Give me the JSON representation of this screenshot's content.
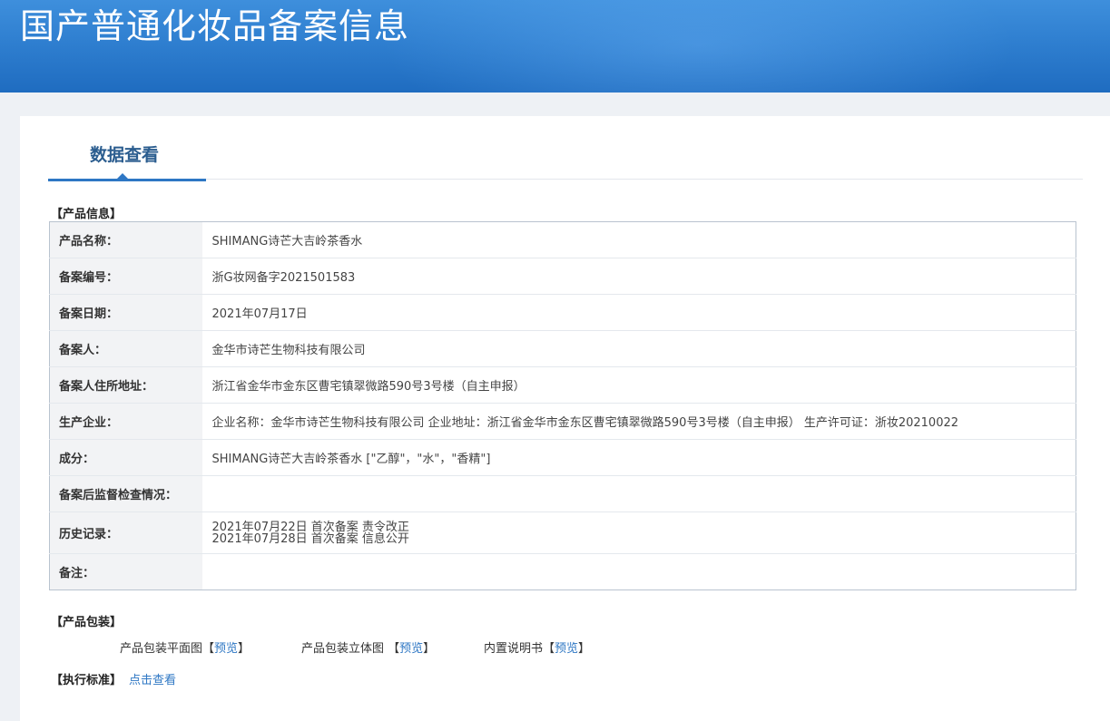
{
  "header": {
    "title": "国产普通化妆品备案信息"
  },
  "tabs": [
    {
      "label": "数据查看"
    }
  ],
  "sections": {
    "product_info": "【产品信息】",
    "packaging": "【产品包装】",
    "standard": "【执行标准】"
  },
  "product_info": {
    "rows": [
      {
        "label": "产品名称：",
        "value": "SHIMANG诗芒大吉岭茶香水"
      },
      {
        "label": "备案编号：",
        "value": "浙G妆网备字2021501583"
      },
      {
        "label": "备案日期：",
        "value": "2021年07月17日"
      },
      {
        "label": "备案人：",
        "value": "金华市诗芒生物科技有限公司"
      },
      {
        "label": "备案人住所地址：",
        "value": "浙江省金华市金东区曹宅镇翠微路590号3号楼（自主申报）"
      },
      {
        "label": "生产企业：",
        "value": "企业名称：金华市诗芒生物科技有限公司 企业地址：浙江省金华市金东区曹宅镇翠微路590号3号楼（自主申报） 生产许可证：浙妆20210022"
      },
      {
        "label": "成分：",
        "value": "SHIMANG诗芒大吉岭茶香水 [\"乙醇\"，\"水\"，\"香精\"]"
      },
      {
        "label": "备案后监督检查情况：",
        "value": ""
      }
    ],
    "history": {
      "label": "历史记录：",
      "entries": [
        "2021年07月22日 首次备案 责令改正",
        "2021年07月28日 首次备案 信息公开"
      ]
    },
    "note": {
      "label": "备注：",
      "value": ""
    }
  },
  "packaging": {
    "items": [
      {
        "label": "产品包装平面图【",
        "link": "预览",
        "suffix": "】"
      },
      {
        "label": "产品包装立体图 【",
        "link": "预览",
        "suffix": "】"
      },
      {
        "label": "内置说明书【",
        "link": "预览",
        "suffix": "】"
      }
    ]
  },
  "standard": {
    "link": "点击查看"
  },
  "colors": {
    "banner": "#2f7fd0",
    "accent": "#2e77c4",
    "tab_text": "#2b5d8f",
    "label_bg": "#f2f3f5"
  }
}
